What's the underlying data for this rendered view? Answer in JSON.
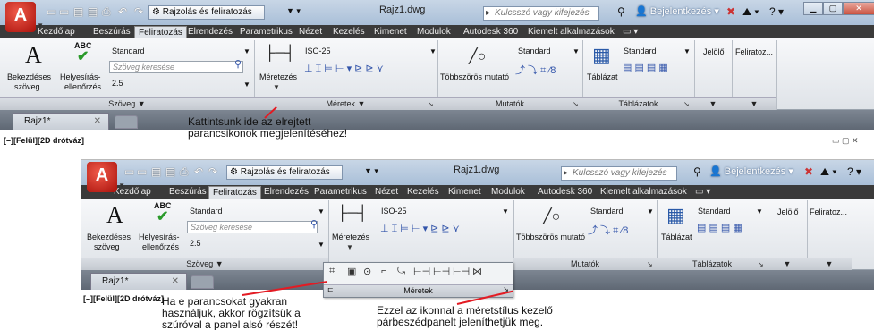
{
  "app": {
    "workspace": "Rajzolás és feliratozás",
    "document": "Rajz1.dwg",
    "search_placeholder": "Kulcsszó vagy kifejezés",
    "signin": "Bejelentkezés"
  },
  "menu": [
    "Kezdőlap",
    "Beszúrás",
    "Feliratozás",
    "Elrendezés",
    "Parametrikus",
    "Nézet",
    "Kezelés",
    "Kimenet",
    "Modulok",
    "Autodesk 360",
    "Kiemelt alkalmazások"
  ],
  "active_menu": "Feliratozás",
  "ribbon": {
    "text_panel": {
      "big_label_1": "Bekezdéses",
      "big_label_2": "szöveg",
      "spell_label_1": "Helyesírás-",
      "spell_label_2": "ellenőrzés",
      "abc": "ABC",
      "style": "Standard",
      "search_placeholder": "Szöveg keresése",
      "height": "2.5",
      "footer": "Szöveg ▼"
    },
    "dim_panel": {
      "big_label": "Méretezés",
      "style": "ISO-25",
      "footer": "Méretek ▼",
      "flyout_footer": "Méretek"
    },
    "leader_panel": {
      "big_label": "Többszörös mutató",
      "style": "Standard",
      "footer": "Mutatók"
    },
    "table_panel": {
      "big_label": "Táblázat",
      "style": "Standard",
      "footer": "Táblázatok"
    },
    "extra_labels": [
      "Jelölő",
      "Feliratoz..."
    ]
  },
  "tabs": {
    "doc_tab": "Rajz1*",
    "viewport": "[–][Felül][2D drótváz]"
  },
  "callouts": {
    "c1_line1": "Kattintsunk ide az elrejtett",
    "c1_line2": "parancsikonok megjelenítéséhez!",
    "c2_line1": "Ha e parancsokat gyakran",
    "c2_line2": "használjuk, akkor rögzítsük a",
    "c2_line3": "szúróval a panel alsó részét!",
    "c3_line1": "Ezzel az ikonnal a méretstílus kezelő",
    "c3_line2": "párbeszédpanelt jeleníthetjük meg."
  }
}
